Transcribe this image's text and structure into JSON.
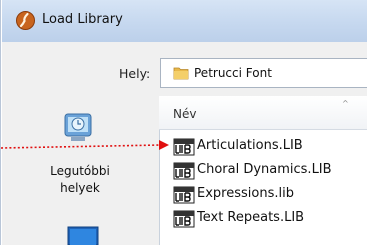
{
  "window": {
    "title": "Load Library",
    "app_icon": "finale-app-icon"
  },
  "location": {
    "label": "Hely:",
    "current_folder": "Petrucci Font",
    "folder_icon": "folder-icon"
  },
  "places": [
    {
      "label": "Legutóbbi helyek",
      "icon": "recent-places-icon"
    },
    {
      "label": "",
      "icon": "desktop-icon"
    }
  ],
  "file_list": {
    "column_header": "Név",
    "sort_indicator": "^",
    "files": [
      {
        "name": "Articulations.LIB",
        "icon": "lib-file-icon"
      },
      {
        "name": "Choral Dynamics.LIB",
        "icon": "lib-file-icon"
      },
      {
        "name": "Expressions.lib",
        "icon": "lib-file-icon"
      },
      {
        "name": "Text Repeats.LIB",
        "icon": "lib-file-icon"
      }
    ]
  },
  "annotation": {
    "arrow_color": "#e01010",
    "points_to": "Articulations.LIB"
  }
}
